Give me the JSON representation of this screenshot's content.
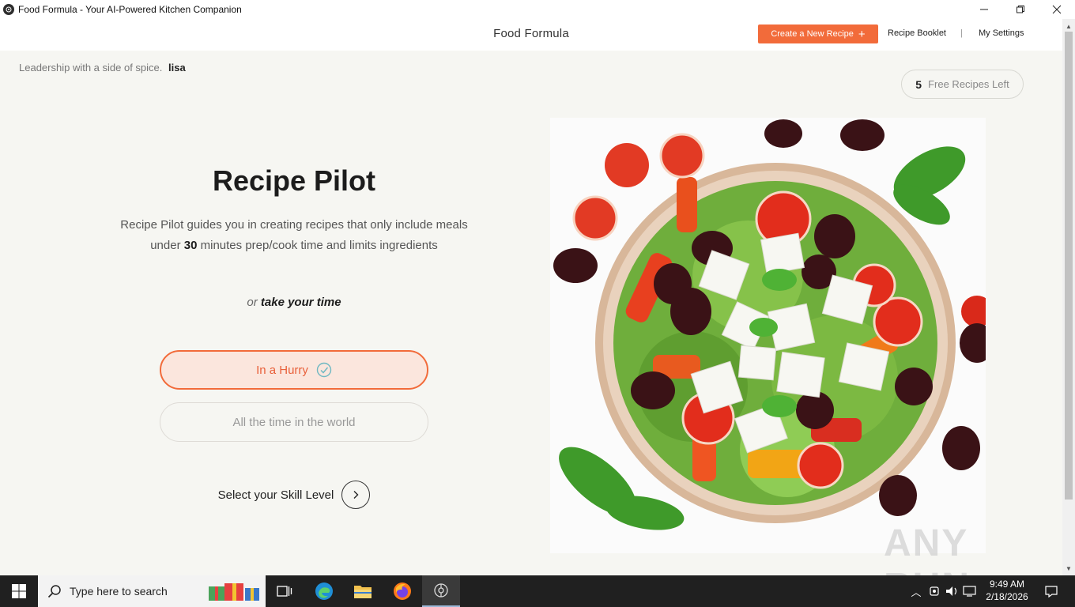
{
  "window": {
    "title": "Food Formula - Your AI-Powered Kitchen Companion",
    "controls": [
      "minimize-icon",
      "restore-icon",
      "close-icon"
    ]
  },
  "header": {
    "brand": "Food Formula",
    "create_label": "Create a New Recipe",
    "create_icon": "+",
    "links": [
      "Recipe Booklet",
      "My Settings"
    ],
    "separator": "|"
  },
  "main": {
    "tagline": "Leadership with a side of spice.",
    "username": "lisa",
    "free_count": "5",
    "free_label": "Free Recipes Left",
    "heading": "Recipe Pilot",
    "desc_part1": "Recipe Pilot guides you in creating recipes that only include meals",
    "desc_part2_pre": "under",
    "desc_part2_num": "30",
    "desc_part2_post": "minutes prep/cook time and limits ingredients",
    "or_prefix": "or",
    "or_bold": "take your time",
    "option_hurry": "In a Hurry",
    "option_time": "All the time in the world",
    "skill_label": "Select your Skill Level"
  },
  "watermark": "ANY RUN",
  "taskbar": {
    "search_placeholder": "Type here to search",
    "time": "9:49 AM",
    "date": "2/18/2026"
  },
  "colors": {
    "accent": "#f26b3a",
    "main_bg": "#f6f6f2",
    "taskbar_bg": "#202020"
  }
}
